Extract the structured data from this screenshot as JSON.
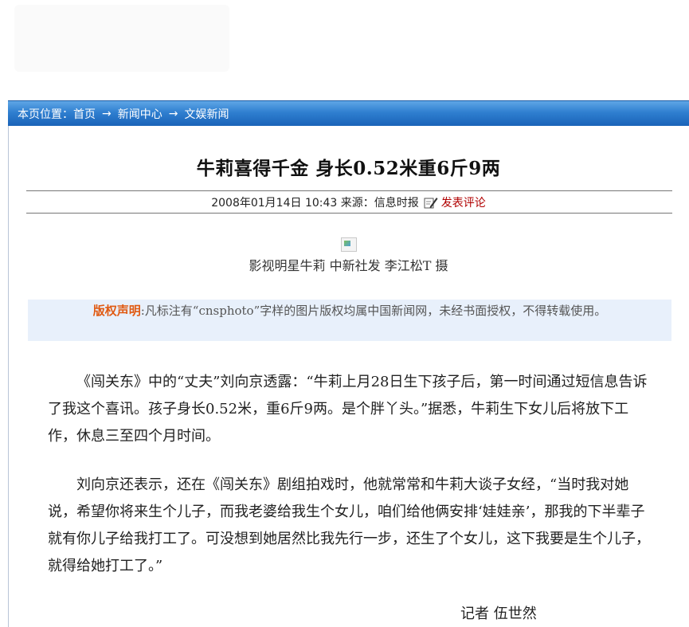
{
  "breadcrumb": {
    "prefix": "本页位置：",
    "items": [
      "首页",
      "新闻中心",
      "文娱新闻"
    ],
    "separator": "→"
  },
  "article": {
    "title": "牛莉喜得千金 身长0.52米重6斤9两",
    "date": "2008年01月14日  10:43",
    "source": "来源：信息时报",
    "comment_link": "发表评论",
    "photo_caption": "影视明星牛莉 中新社发 李江松T 摄",
    "copyright_label": "版权声明",
    "copyright_text": ":凡标注有“cnsphoto”字样的图片版权均属中国新闻网，未经书面授权，不得转载使用。",
    "paragraphs": [
      "《闯关东》中的“丈夫”刘向京透露：“牛莉上月28日生下孩子后，第一时间通过短信息告诉了我这个喜讯。孩子身长0.52米，重6斤9两。是个胖丫头。”据悉，牛莉生下女儿后将放下工作，休息三至四个月时间。",
      "刘向京还表示，还在《闯关东》剧组拍戏时，他就常常和牛莉大谈子女经，“当时我对她说，希望你将来生个儿子，而我老婆给我生个女儿，咱们给他俩安排‘娃娃亲’，那我的下半辈子就有你儿子给我打工了。可没想到她居然比我先行一步，还生了个女儿，这下我要是生个儿子，就得给她打工了。”"
    ],
    "byline": "记者 伍世然"
  },
  "icons": {
    "comment": "pencil-edit-icon",
    "photo": "broken-image-icon"
  },
  "colors": {
    "breadcrumb_bg": "#2f7fd0",
    "comment_link": "#b00000",
    "copyright_label": "#e05a12",
    "notice_bg": "#e8f0fb"
  }
}
